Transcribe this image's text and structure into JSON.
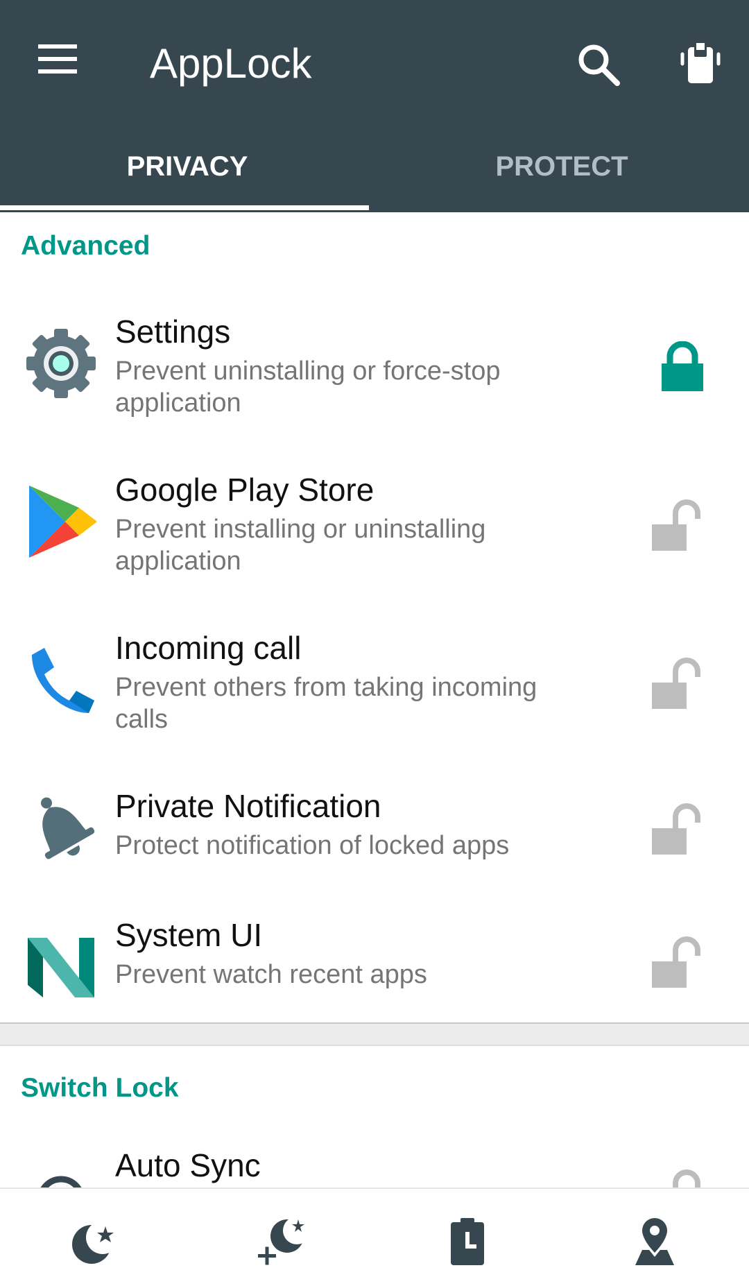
{
  "app": {
    "title": "AppLock"
  },
  "tabs": [
    {
      "label": "PRIVACY",
      "selected": true
    },
    {
      "label": "PROTECT",
      "selected": false
    }
  ],
  "sections": [
    {
      "header": "Advanced",
      "items": [
        {
          "title": "Settings",
          "description": "Prevent uninstalling or force-stop application",
          "icon": "settings-gear-icon",
          "locked": true
        },
        {
          "title": "Google Play Store",
          "description": "Prevent installing or uninstalling application",
          "icon": "play-store-icon",
          "locked": false
        },
        {
          "title": "Incoming call",
          "description": "Prevent others from taking incoming calls",
          "icon": "phone-icon",
          "locked": false
        },
        {
          "title": "Private Notification",
          "description": "Protect notification of locked apps",
          "icon": "bell-icon",
          "locked": false
        },
        {
          "title": "System UI",
          "description": "Prevent watch recent apps",
          "icon": "system-ui-n-icon",
          "locked": false
        }
      ]
    },
    {
      "header": "Switch Lock",
      "items": [
        {
          "title": "Auto Sync",
          "icon": "sync-icon",
          "locked": false
        }
      ]
    }
  ],
  "bottom_nav": [
    {
      "icon": "moon-star-icon"
    },
    {
      "icon": "add-moon-icon"
    },
    {
      "icon": "clipboard-timer-icon"
    },
    {
      "icon": "location-pin-icon"
    }
  ],
  "colors": {
    "toolbar": "#37474f",
    "accent": "#009688",
    "lock_inactive": "#bdbdbd",
    "tab_inactive": "#b0bec5"
  }
}
